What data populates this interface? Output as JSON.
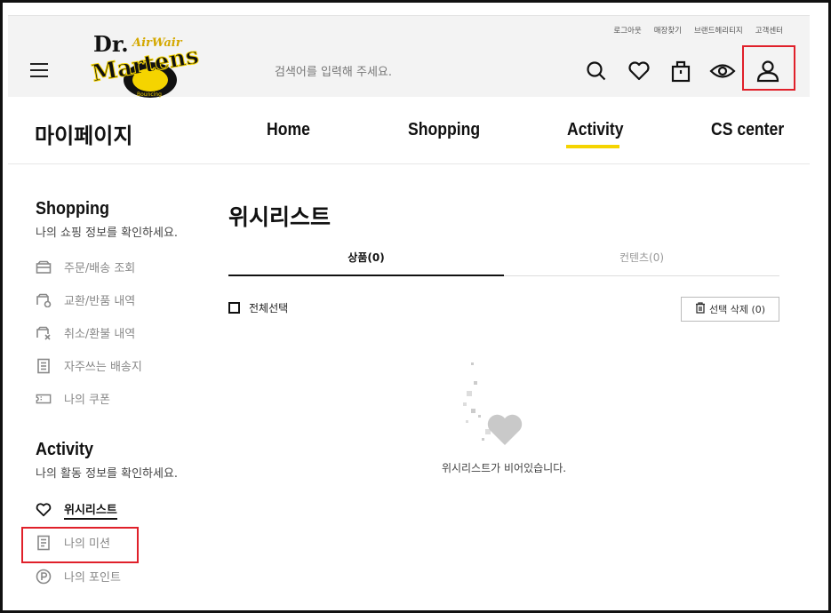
{
  "header": {
    "utility_links": [
      "로그아웃",
      "매장찾기",
      "브랜드헤리티지",
      "고객센터"
    ],
    "search_placeholder": "검색어를 입력해 주세요.",
    "logo": {
      "line1": "Dr.",
      "line2": "Martens",
      "air": "AirWair",
      "tag": "Bouncing"
    },
    "icons": [
      "search-icon",
      "heart-icon",
      "shopping-bag-icon",
      "eye-icon",
      "user-icon"
    ]
  },
  "nav": {
    "title": "마이페이지",
    "items": [
      "Home",
      "Shopping",
      "Activity",
      "CS center"
    ],
    "active": "Activity",
    "accent_color": "#f5d400"
  },
  "sidebar": {
    "shopping": {
      "heading": "Shopping",
      "subtitle": "나의 쇼핑 정보를 확인하세요.",
      "items": [
        {
          "label": "주문/배송 조회",
          "icon": "box-icon"
        },
        {
          "label": "교환/반품 내역",
          "icon": "exchange-box-icon"
        },
        {
          "label": "취소/환불 내역",
          "icon": "cancel-box-icon"
        },
        {
          "label": "자주쓰는 배송지",
          "icon": "address-book-icon"
        },
        {
          "label": "나의 쿠폰",
          "icon": "coupon-icon"
        }
      ]
    },
    "activity": {
      "heading": "Activity",
      "subtitle": "나의 활동 정보를 확인하세요.",
      "items": [
        {
          "label": "위시리스트",
          "icon": "heart-icon",
          "active": true
        },
        {
          "label": "나의 미션",
          "icon": "mission-icon"
        },
        {
          "label": "나의 포인트",
          "icon": "point-icon"
        }
      ]
    }
  },
  "main": {
    "title": "위시리스트",
    "tabs": [
      {
        "label": "상품(0)",
        "active": true
      },
      {
        "label": "컨텐츠(0)",
        "active": false
      }
    ],
    "select_all_label": "전체선택",
    "delete_button_label": "선택 삭제 (0)",
    "empty_message": "위시리스트가 비어있습니다."
  },
  "highlight_color": "#e0202a"
}
